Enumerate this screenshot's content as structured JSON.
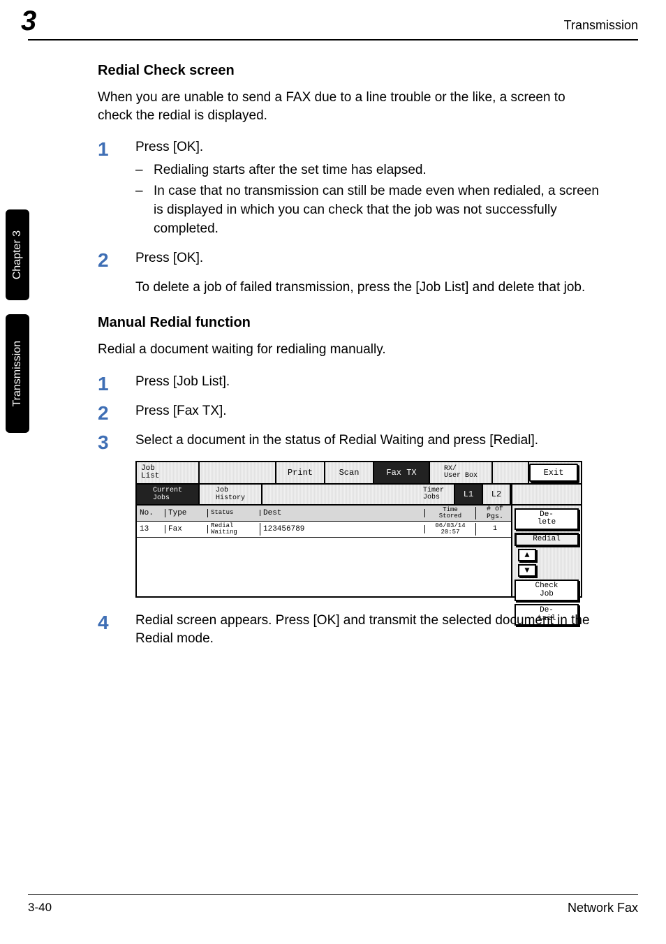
{
  "header": {
    "chapter_num": "3",
    "right_label": "Transmission"
  },
  "sidetabs": {
    "top": "Chapter 3",
    "bottom": "Transmission"
  },
  "sections": {
    "redial_check_title": "Redial Check screen",
    "redial_check_intro": "When you are unable to send a FAX due to a line trouble or the like, a screen to check the redial is displayed.",
    "step1_text": "Press [OK].",
    "step1_bullets": [
      "Redialing starts after the set time has elapsed.",
      "In case that no transmission can still be made even when redialed, a screen is displayed in which you can check that the job was not successfully completed."
    ],
    "step2_text": "Press [OK].",
    "step2_after": "To delete a job of failed transmission, press the [Job List] and delete that job.",
    "manual_redial_title": "Manual Redial function",
    "manual_redial_intro": "Redial a document waiting for redialing manually.",
    "mr_step1": "Press [Job List].",
    "mr_step2": "Press [Fax TX].",
    "mr_step3": "Select a document in the status of Redial Waiting and press [Redial].",
    "mr_step4": "Redial screen appears. Press [OK] and transmit the selected document in the Redial mode."
  },
  "screenshot": {
    "top": {
      "job_list": "Job\nList",
      "print": "Print",
      "scan": "Scan",
      "fax_tx": "Fax TX",
      "rx_userbox": "RX/\nUser Box",
      "exit": "Exit"
    },
    "sec": {
      "current_jobs": "Current\nJobs",
      "job_history": "Job\nHistory",
      "timer_jobs": "Timer\nJobs",
      "l1": "L1",
      "l2": "L2"
    },
    "thead": {
      "no": "No.",
      "type": "Type",
      "status": "Status",
      "dest": "Dest",
      "time_stored": "Time\nStored",
      "pgs": "# of\nPgs."
    },
    "rows": [
      {
        "no": "13",
        "type": "Fax",
        "status": "Redial\nWaiting",
        "dest": "123456789",
        "time_stored": "06/03/14\n20:57",
        "pgs": "1"
      }
    ],
    "right": {
      "delete": "De-\nlete",
      "redial": "Redial",
      "check_job": "Check\nJob",
      "detail": "De-\ntail"
    }
  },
  "footer": {
    "page_num": "3-40",
    "doc_title": "Network Fax"
  }
}
